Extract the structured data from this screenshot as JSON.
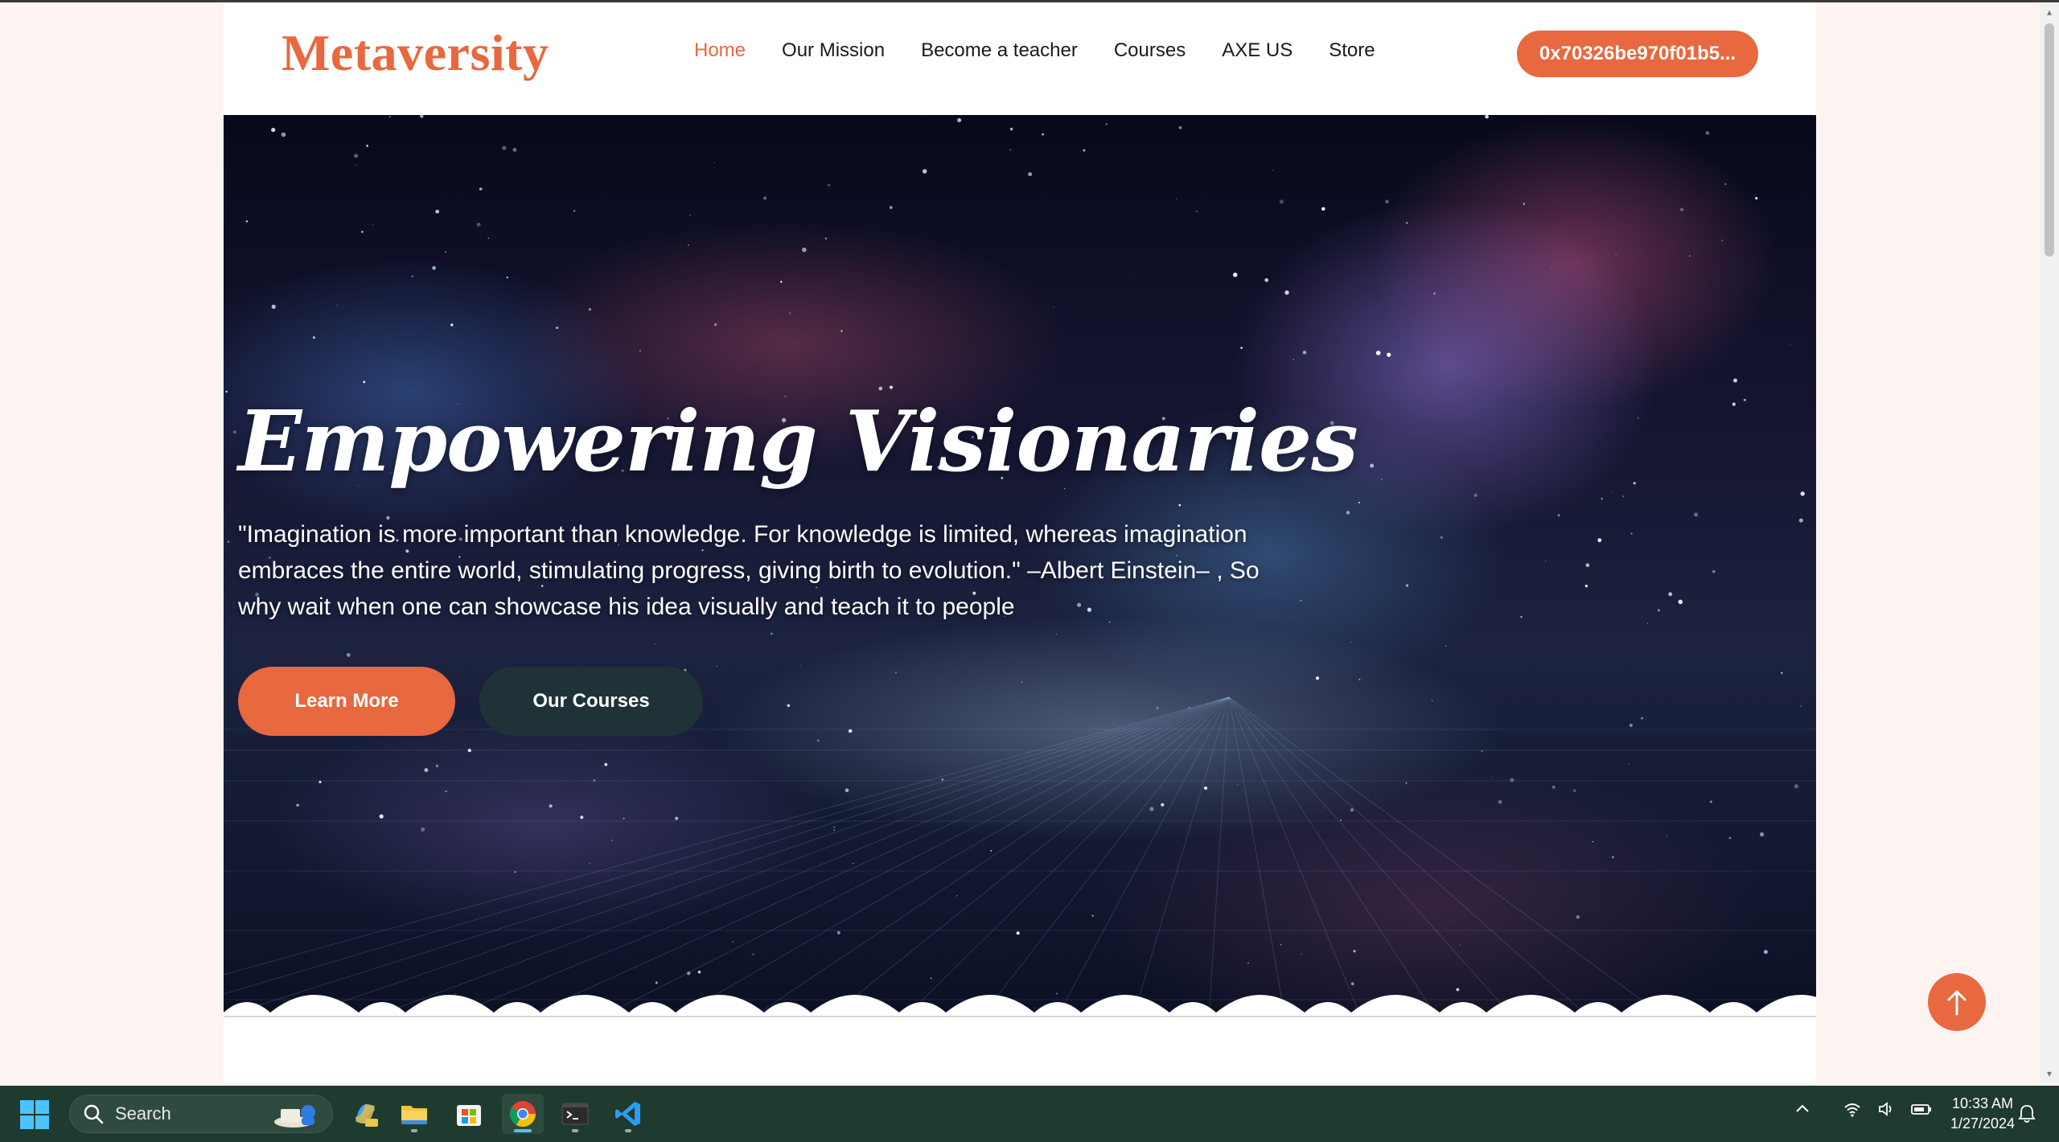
{
  "header": {
    "logo": "Metaversity",
    "nav": [
      {
        "label": "Home",
        "active": true
      },
      {
        "label": "Our Mission",
        "active": false
      },
      {
        "label": "Become a teacher",
        "active": false
      },
      {
        "label": "Courses",
        "active": false
      },
      {
        "label": "AXE US",
        "active": false
      },
      {
        "label": "Store",
        "active": false
      }
    ],
    "wallet_address": "0x70326be970f01b5..."
  },
  "hero": {
    "title": "Empowering Visionaries",
    "quote": "\"Imagination is more important than knowledge. For knowledge is limited, whereas imagination embraces the entire world, stimulating progress, giving birth to evolution.\" –Albert Einstein– , So why wait when one can showcase his idea visually and teach it to people",
    "buttons": {
      "learn_more": "Learn More",
      "our_courses": "Our Courses"
    }
  },
  "scroll_top_icon": "arrow-up-icon",
  "taskbar": {
    "search_label": "Search",
    "apps": [
      "copilot-icon",
      "file-explorer-icon",
      "microsoft-store-icon",
      "chrome-icon",
      "terminal-icon",
      "vscode-icon"
    ],
    "tray_icons": [
      "chevron-up-icon",
      "wifi-icon",
      "volume-icon",
      "battery-icon"
    ],
    "time": "10:33 AM",
    "date": "1/27/2024"
  },
  "colors": {
    "accent": "#e8683f",
    "dark_button": "#1f3232",
    "taskbar": "#1f3a2e"
  }
}
